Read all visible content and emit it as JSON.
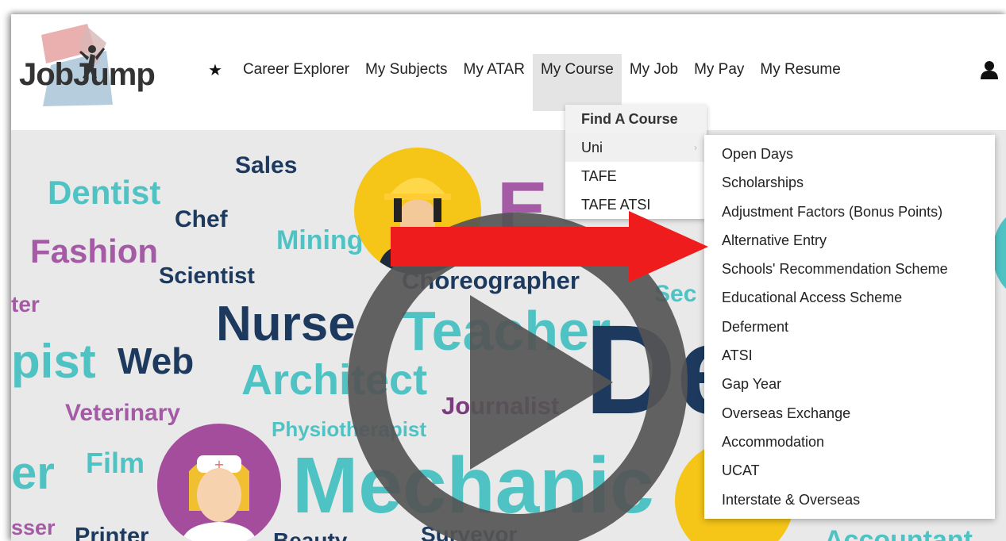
{
  "brand": {
    "logo_text": "JobJump"
  },
  "nav": {
    "star_icon": "star-icon",
    "items": [
      "Career Explorer",
      "My Subjects",
      "My ATAR",
      "My Course",
      "My Job",
      "My Pay",
      "My Resume"
    ],
    "active": "My Course",
    "user_icon": "user-icon"
  },
  "course_menu": {
    "items": [
      "Find A Course",
      "Uni",
      "TAFE",
      "TAFE ATSI"
    ]
  },
  "uni_menu": {
    "items": [
      "Open Days",
      "Scholarships",
      "Adjustment Factors (Bonus Points)",
      "Alternative Entry",
      "Schools' Recommendation Scheme",
      "Educational Access Scheme",
      "Deferment",
      "ATSI",
      "Gap Year",
      "Overseas Exchange",
      "Accommodation",
      "UCAT",
      "Interstate & Overseas"
    ]
  },
  "hero_words": {
    "sales": "Sales",
    "dentist": "Dentist",
    "chef": "Chef",
    "fashion": "Fashion",
    "mining": "Mining",
    "scientist": "Scientist",
    "ter": "ter",
    "choreographer": "Choreographer",
    "nurse": "Nurse",
    "teacher": "Teacher",
    "pist": "pist",
    "web": "Web",
    "architect": "Architect",
    "journalist": "Journalist",
    "veterinary": "Veterinary",
    "physiotherapist": "Physiotherapist",
    "er": "er",
    "film": "Film",
    "mechanic": "Mechanic",
    "sser": "sser",
    "printer": "Printer",
    "beauty": "Beauty",
    "surveyor": "Surveyor",
    "accountant": "Accountant",
    "sec": "Sec",
    "big_d": "De",
    "e": "E"
  },
  "colors": {
    "teal": "#4fc3c4",
    "navy": "#1d3a5e",
    "purple": "#a55aa6",
    "arrow": "#ee1c1c",
    "play": "#555555"
  }
}
